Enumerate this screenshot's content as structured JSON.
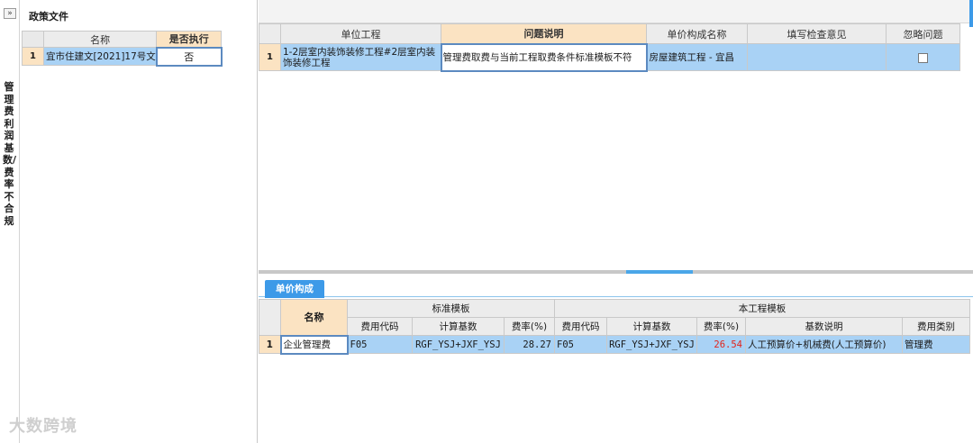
{
  "left_strip": {
    "collapse_icon": "»",
    "vertical_title": "管理费利润基数/费率不合规"
  },
  "policy": {
    "title": "政策文件",
    "columns": [
      "名称",
      "是否执行"
    ],
    "rows": [
      {
        "num": "1",
        "name": "宜市住建文[2021]17号文",
        "execute": "否"
      }
    ]
  },
  "issues": {
    "columns": [
      "单位工程",
      "问题说明",
      "单价构成名称",
      "填写检查意见",
      "忽略问题"
    ],
    "rows": [
      {
        "num": "1",
        "unit": "1-2层室内装饰装修工程#2层室内装饰装修工程",
        "problem": "管理费取费与当前工程取费条件标准模板不符",
        "price_name": "房屋建筑工程 - 宜昌",
        "opinion": "",
        "ignore": false
      }
    ]
  },
  "tabs": {
    "unit_price": "单价构成"
  },
  "price": {
    "name_header": "名称",
    "group_standard": "标准模板",
    "group_project": "本工程模板",
    "sub_headers": [
      "费用代码",
      "计算基数",
      "费率(%)",
      "费用代码",
      "计算基数",
      "费率(%)",
      "基数说明",
      "费用类别"
    ],
    "rows": [
      {
        "num": "1",
        "name": "企业管理费",
        "std_code": "F05",
        "std_base": "RGF_YSJ+JXF_YSJ",
        "std_rate": "28.27",
        "prj_code": "F05",
        "prj_base": "RGF_YSJ+JXF_YSJ",
        "prj_rate": "26.54",
        "base_desc": "人工预算价+机械费(人工预算价)",
        "category": "管理费"
      }
    ]
  },
  "watermark": "大数跨境",
  "colors": {
    "accent": "#3d9ae8",
    "selected_row": "#a9d2f5",
    "header_orange": "#fbe3c2",
    "mismatch": "#e2231a"
  }
}
